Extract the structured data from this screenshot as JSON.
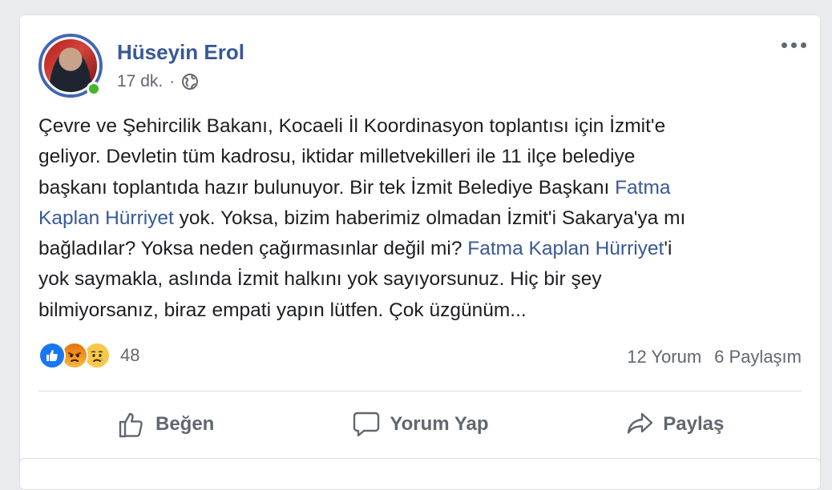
{
  "post": {
    "author": "Hüseyin Erol",
    "time": "17 dk.",
    "separator": "·",
    "privacy_icon": "globe-icon",
    "more_icon": "more-options-icon",
    "lines": [
      [
        {
          "text": "Çevre ve Şehircilik Bakanı, Kocaeli İl Koordinasyon toplantısı için İzmit'e"
        }
      ],
      [
        {
          "text": "geliyor. Devletin tüm kadrosu, iktidar milletvekilleri ile 11 ilçe belediye"
        }
      ],
      [
        {
          "text": "başkanı toplantıda hazır bulunuyor. Bir tek İzmit Belediye Başkanı "
        },
        {
          "text": "Fatma",
          "mention": true
        }
      ],
      [
        {
          "text": "Kaplan Hürriyet",
          "mention": true
        },
        {
          "text": " yok. Yoksa, bizim haberimiz olmadan İzmit'i Sakarya'ya mı"
        }
      ],
      [
        {
          "text": "bağladılar? Yoksa neden çağırmasınlar değil mi? "
        },
        {
          "text": "Fatma Kaplan Hürriyet",
          "mention": true
        },
        {
          "text": "'i"
        }
      ],
      [
        {
          "text": "yok saymakla, aslında İzmit halkını yok sayıyorsunuz. Hiç bir şey"
        }
      ],
      [
        {
          "text": "bilmiyorsanız, biraz empati yapın lütfen. Çok üzgünüm..."
        }
      ]
    ]
  },
  "reactions": {
    "types": [
      "like-icon",
      "angry-icon",
      "sad-icon"
    ],
    "count": "48"
  },
  "stats": {
    "comments": "12 Yorum",
    "shares": "6 Paylaşım"
  },
  "actions": {
    "like": "Beğen",
    "comment": "Yorum Yap",
    "share": "Paylaş"
  },
  "colors": {
    "link": "#385898",
    "secondary": "#606770",
    "online": "#42b72a",
    "like_blue": "#1877f2"
  }
}
